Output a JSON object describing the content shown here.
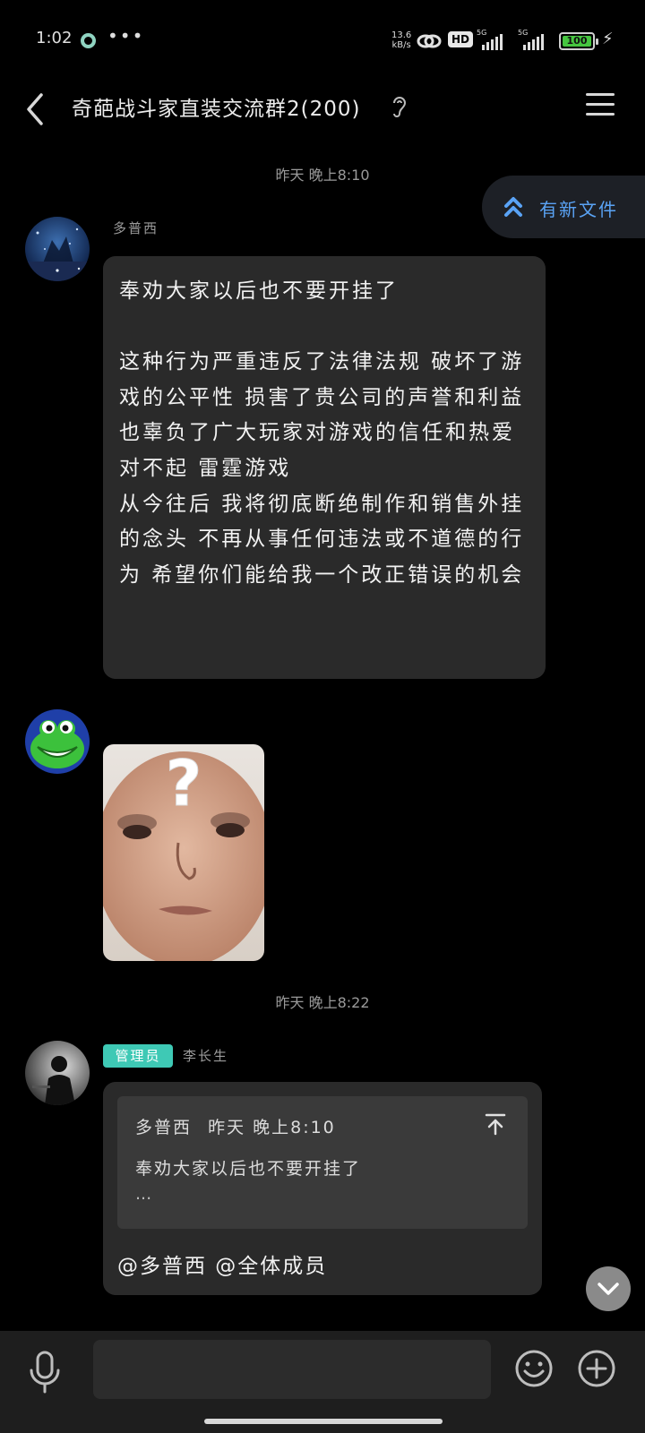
{
  "status_bar": {
    "time": "1:02",
    "net_speed_value": "13.6",
    "net_speed_unit": "kB/s",
    "hd_label": "HD",
    "signal_1_tag": "5G",
    "signal_2_tag": "5G",
    "battery_level": "100",
    "battery_fill_percent": 100
  },
  "header": {
    "title": "奇葩战斗家直装交流群2(200)"
  },
  "new_file_pill": {
    "label": "有新文件"
  },
  "messages": [
    {
      "timestamp": "昨天 晚上8:10",
      "sender": "多普西",
      "text": "奉劝大家以后也不要开挂了\n\n这种行为严重违反了法律法规 破坏了游戏的公平性 损害了贵公司的声誉和利益 也辜负了广大玩家对游戏的信任和热爱\n对不起 雷霆游戏\n从今往后 我将彻底断绝制作和销售外挂的念头 不再从事任何违法或不道德的行为 希望你们能给我一个改正错误的机会"
    },
    {
      "timestamp": "昨天 晚上8:22",
      "role_badge": "管理员",
      "sender": "李长生",
      "quote": {
        "sender": "多普西",
        "time": "昨天 晚上8:10",
        "text": "奉劝大家以后也不要开挂了",
        "more": "..."
      },
      "text": "@多普西 @全体成员"
    }
  ],
  "input": {
    "placeholder": "",
    "value": ""
  }
}
